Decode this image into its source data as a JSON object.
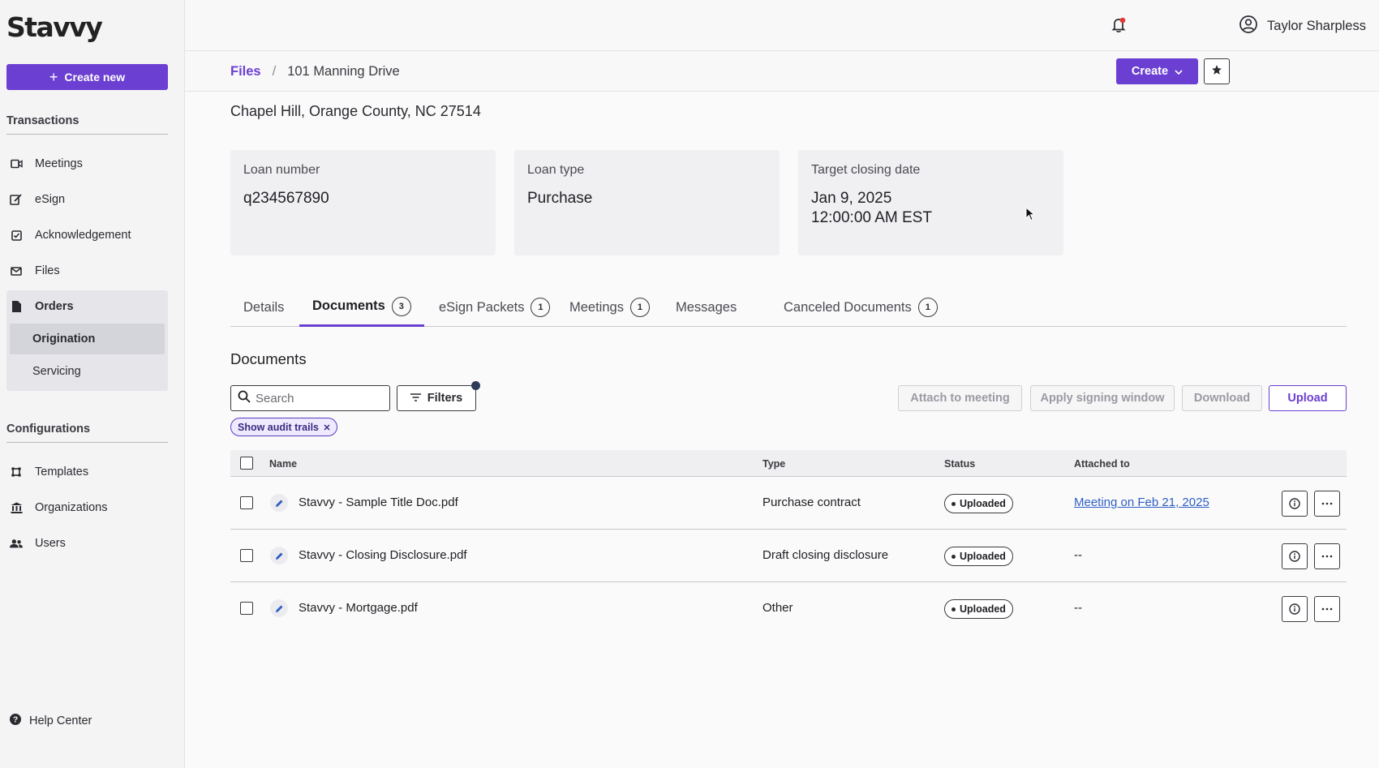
{
  "app": {
    "logo": "Stavvy",
    "create_new_label": "Create new"
  },
  "sidebar": {
    "transactions_title": "Transactions",
    "transactions": [
      {
        "label": "Meetings",
        "icon": "video-icon"
      },
      {
        "label": "eSign",
        "icon": "signature-icon"
      },
      {
        "label": "Acknowledgement",
        "icon": "checkbox-icon"
      },
      {
        "label": "Files",
        "icon": "mail-icon"
      },
      {
        "label": "Orders",
        "icon": "document-icon"
      }
    ],
    "orders_sub": [
      {
        "label": "Origination",
        "active": true
      },
      {
        "label": "Servicing",
        "active": false
      }
    ],
    "configurations_title": "Configurations",
    "configurations": [
      {
        "label": "Templates",
        "icon": "template-icon"
      },
      {
        "label": "Organizations",
        "icon": "bank-icon"
      },
      {
        "label": "Users",
        "icon": "users-icon"
      }
    ],
    "help_label": "Help Center"
  },
  "topbar": {
    "user_name": "Taylor Sharpless"
  },
  "breadcrumb": {
    "root": "Files",
    "separator": "/",
    "current": "101 Manning Drive"
  },
  "header": {
    "create_label": "Create",
    "address": "Chapel Hill, Orange County, NC 27514"
  },
  "cards": [
    {
      "label": "Loan number",
      "value": "q234567890"
    },
    {
      "label": "Loan type",
      "value": "Purchase"
    },
    {
      "label": "Target closing date",
      "value_line1": "Jan 9, 2025",
      "value_line2": "12:00:00 AM EST"
    }
  ],
  "tabs": [
    {
      "label": "Details",
      "count": null
    },
    {
      "label": "Documents",
      "count": "3",
      "active": true
    },
    {
      "label": "eSign Packets",
      "count": "1"
    },
    {
      "label": "Meetings",
      "count": "1"
    },
    {
      "label": "Messages",
      "count": null
    },
    {
      "label": "Canceled Documents",
      "count": "1"
    }
  ],
  "documents": {
    "heading": "Documents",
    "search_placeholder": "Search",
    "filters_label": "Filters",
    "actions": {
      "attach": "Attach to meeting",
      "signing": "Apply signing window",
      "download": "Download",
      "upload": "Upload"
    },
    "chip_label": "Show audit trails",
    "columns": {
      "name": "Name",
      "type": "Type",
      "status": "Status",
      "attached": "Attached to"
    },
    "rows": [
      {
        "name": "Stavvy - Sample Title Doc.pdf",
        "type": "Purchase contract",
        "status": "Uploaded",
        "attached": "Meeting on Feb 21, 2025"
      },
      {
        "name": "Stavvy - Closing Disclosure.pdf",
        "type": "Draft closing disclosure",
        "status": "Uploaded",
        "attached": "--"
      },
      {
        "name": "Stavvy - Mortgage.pdf",
        "type": "Other",
        "status": "Uploaded",
        "attached": "--"
      }
    ]
  },
  "colors": {
    "accent": "#6b3fd1",
    "link": "#2f5fc4",
    "notification": "#e53935"
  }
}
